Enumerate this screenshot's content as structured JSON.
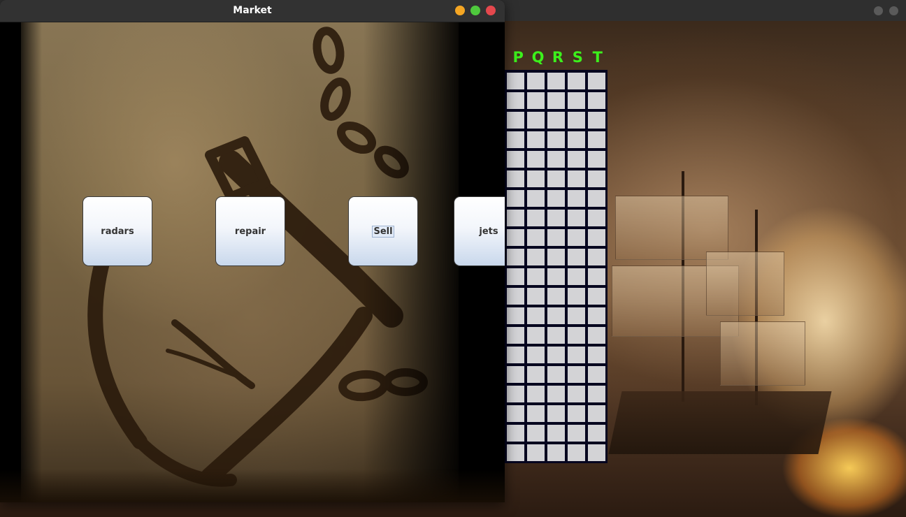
{
  "front_window": {
    "title": "Market",
    "buttons": [
      {
        "label": "radars"
      },
      {
        "label": "repair"
      },
      {
        "label": "Sell"
      },
      {
        "label": "jets"
      }
    ],
    "focused_button": "Sell"
  },
  "game_board": {
    "column_labels": [
      "P",
      "Q",
      "R",
      "S",
      "T"
    ],
    "rows": 20,
    "columns": 5,
    "label_color": "#3cf01c",
    "cell_color": "#d3d3d6",
    "border_color": "#05051f"
  },
  "colors": {
    "titlebar": "#323232",
    "close": "#e5484d",
    "minimize": "#f5a623",
    "maximize": "#4fc93d"
  }
}
